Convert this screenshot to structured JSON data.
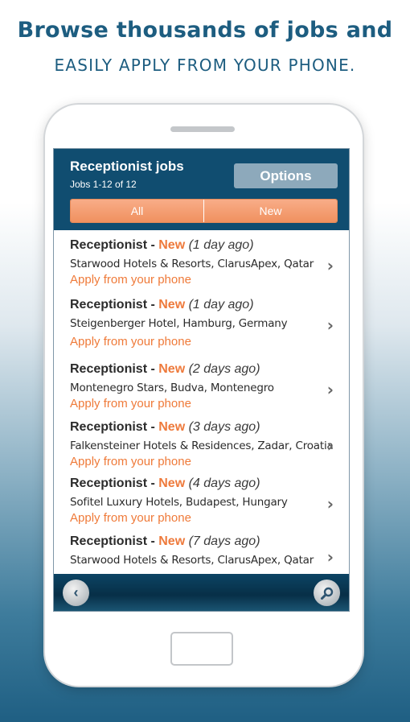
{
  "promo": {
    "headline": "Browse thousands of jobs and",
    "subheadline": "EASILY APPLY FROM YOUR PHONE."
  },
  "header": {
    "title": "Receptionist jobs",
    "subtitle": "Jobs 1-12 of 12",
    "options_label": "Options"
  },
  "tabs": [
    {
      "label": "All"
    },
    {
      "label": "New"
    }
  ],
  "jobs": [
    {
      "title": "Receptionist",
      "separator": " - ",
      "badge": "New",
      "age": "(1 day ago)",
      "company": "Starwood Hotels & Resorts, ClarusApex, Qatar",
      "action": "Apply from your phone"
    },
    {
      "title": "Receptionist",
      "separator": " - ",
      "badge": "New",
      "age": "(1 day ago)",
      "company": "Steigenberger Hotel, Hamburg, Germany",
      "action": "Apply from your phone"
    },
    {
      "title": "Receptionist",
      "separator": " - ",
      "badge": "New",
      "age": "(2 days ago)",
      "company": "Montenegro Stars, Budva, Montenegro",
      "action": "Apply from your phone"
    },
    {
      "title": "Receptionist",
      "separator": " - ",
      "badge": "New",
      "age": "(3 days ago)",
      "company": "Falkensteiner Hotels & Residences, Zadar, Croatia",
      "action": "Apply from your phone"
    },
    {
      "title": "Receptionist",
      "separator": " - ",
      "badge": "New",
      "age": "(4 days ago)",
      "company": "Sofitel Luxury Hotels, Budapest, Hungary",
      "action": "Apply from your phone"
    },
    {
      "title": "Receptionist",
      "separator": " - ",
      "badge": "New",
      "age": "(7 days ago)",
      "company": "Starwood Hotels & Resorts, ClarusApex, Qatar",
      "action": ""
    }
  ],
  "icons": {
    "chevron": "chevron-right-icon",
    "back": "back-arrow-icon",
    "search": "search-icon"
  },
  "colors": {
    "header_bg": "#104d70",
    "accent_orange": "#ee7a3c",
    "tab_orange": "#f0915f",
    "headline_blue": "#1d5d80"
  }
}
